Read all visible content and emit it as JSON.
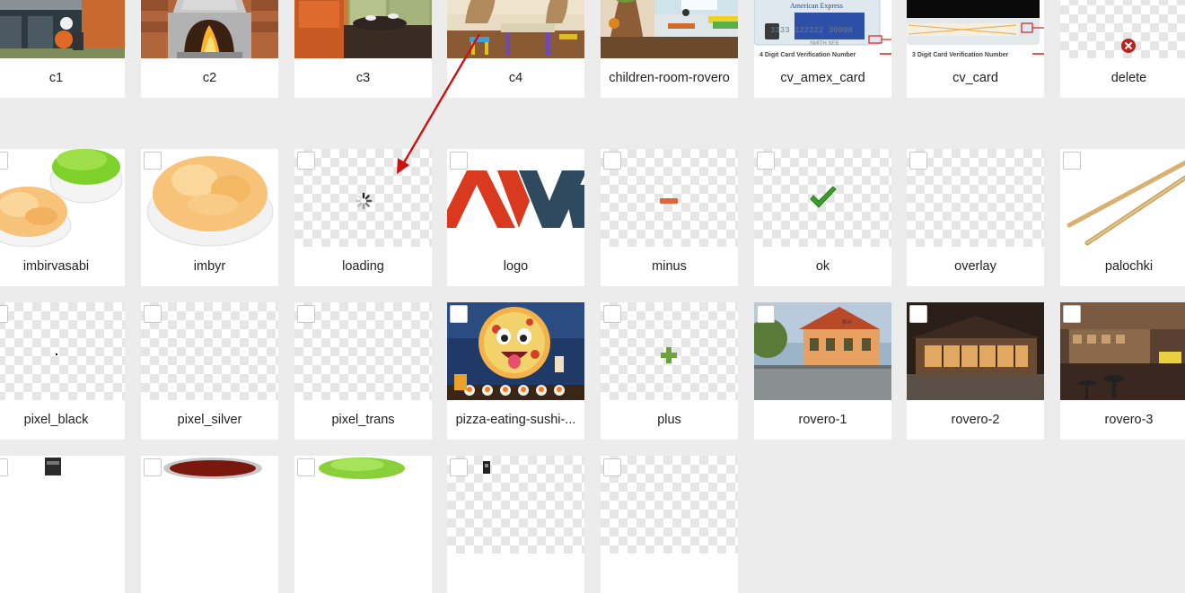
{
  "items": [
    {
      "label": "c1"
    },
    {
      "label": "c2"
    },
    {
      "label": "c3"
    },
    {
      "label": "c4"
    },
    {
      "label": "children-room-rovero"
    },
    {
      "label": "cv_amex_card",
      "card_brand": "American Express",
      "card_number": "3333 122222 30000",
      "card_caption": "4 Digit Card Verification Number"
    },
    {
      "label": "cv_card",
      "card_caption": "3 Digit Card Verification Number"
    },
    {
      "label": "delete"
    },
    {
      "label": "imbirvasabi"
    },
    {
      "label": "imbyr"
    },
    {
      "label": "loading"
    },
    {
      "label": "logo"
    },
    {
      "label": "minus"
    },
    {
      "label": "ok"
    },
    {
      "label": "overlay"
    },
    {
      "label": "palochki"
    },
    {
      "label": "pixel_black"
    },
    {
      "label": "pixel_silver"
    },
    {
      "label": "pixel_trans"
    },
    {
      "label": "pizza-eating-sushi-..."
    },
    {
      "label": "plus"
    },
    {
      "label": "rovero-1"
    },
    {
      "label": "rovero-2"
    },
    {
      "label": "rovero-3"
    },
    {
      "label": ""
    },
    {
      "label": ""
    },
    {
      "label": ""
    },
    {
      "label": ""
    },
    {
      "label": ""
    },
    {
      "label": ""
    }
  ],
  "colors": {
    "annotation_arrow": "#cc1111",
    "page_bg": "#ececec"
  }
}
